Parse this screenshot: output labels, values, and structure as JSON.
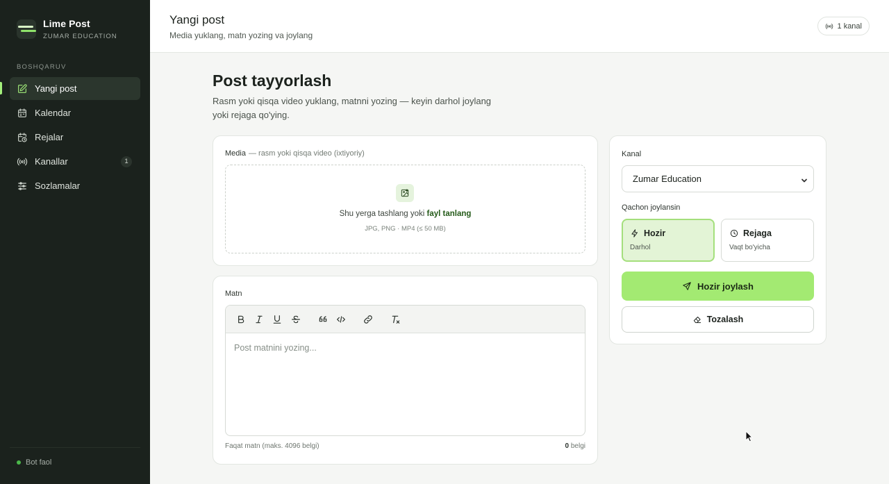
{
  "brand": {
    "name": "Lime Post",
    "subtitle": "ZUMAR EDUCATION"
  },
  "sidebar": {
    "section_label": "BOSHQARUV",
    "items": [
      {
        "label": "Yangi post",
        "icon": "edit-icon",
        "active": true
      },
      {
        "label": "Kalendar",
        "icon": "calendar-icon"
      },
      {
        "label": "Rejalar",
        "icon": "calendar-clock-icon"
      },
      {
        "label": "Kanallar",
        "icon": "broadcast-icon",
        "badge": "1"
      },
      {
        "label": "Sozlamalar",
        "icon": "sliders-icon"
      }
    ],
    "bot_status": "Bot faol"
  },
  "header": {
    "title": "Yangi post",
    "subtitle": "Media yuklang, matn yozing va joylang",
    "channel_count": "1 kanal"
  },
  "page": {
    "heading": "Post tayyorlash",
    "description": "Rasm yoki qisqa video yuklang, matnni yozing — keyin darhol joylang yoki rejaga qo'ying."
  },
  "media": {
    "label": "Media",
    "label_note": "— rasm yoki qisqa video (ixtiyoriy)",
    "drop_text": "Shu yerga tashlang yoki",
    "drop_link": "fayl tanlang",
    "hint": "JPG, PNG · MP4 (≤ 50 MB)"
  },
  "text": {
    "label": "Matn",
    "placeholder": "Post matnini yozing...",
    "footer_left": "Faqat matn (maks. 4096 belgi)",
    "char_count": "0",
    "char_unit": "belgi",
    "toolbar": [
      "bold",
      "italic",
      "underline",
      "strikethrough",
      "quote",
      "code",
      "link",
      "clear-format"
    ]
  },
  "publish": {
    "channel_label": "Kanal",
    "channel_value": "Zumar Education",
    "when_label": "Qachon joylansin",
    "options": [
      {
        "title": "Hozir",
        "subtitle": "Darhol",
        "selected": true
      },
      {
        "title": "Rejaga",
        "subtitle": "Vaqt bo'yicha",
        "selected": false
      }
    ],
    "primary_button": "Hozir joylash",
    "secondary_button": "Tozalash"
  },
  "colors": {
    "accent": "#a3ea72",
    "sidebar_bg": "#1b221d",
    "selected_bg": "#e3f4d6"
  }
}
